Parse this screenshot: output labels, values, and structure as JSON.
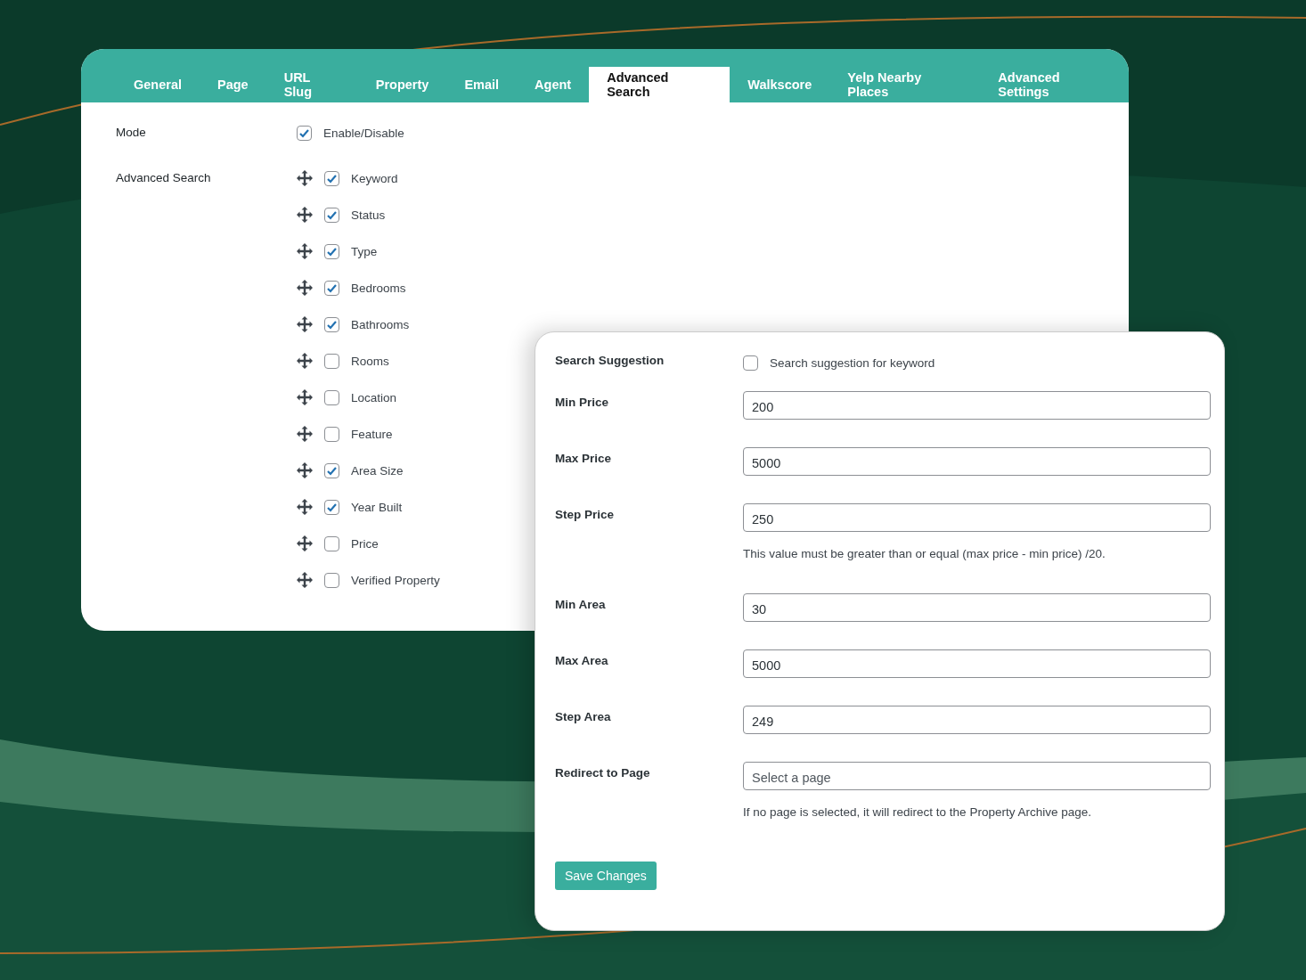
{
  "tabs": [
    {
      "label": "General",
      "selected": false
    },
    {
      "label": "Page",
      "selected": false
    },
    {
      "label": "URL Slug",
      "selected": false
    },
    {
      "label": "Property",
      "selected": false
    },
    {
      "label": "Email",
      "selected": false
    },
    {
      "label": "Agent",
      "selected": false
    },
    {
      "label": "Advanced Search",
      "selected": true
    },
    {
      "label": "Walkscore",
      "selected": false
    },
    {
      "label": "Yelp Nearby Places",
      "selected": false
    },
    {
      "label": "Advanced Settings",
      "selected": false
    }
  ],
  "mode": {
    "label": "Mode",
    "option_label": "Enable/Disable",
    "checked": true
  },
  "advanced_search": {
    "label": "Advanced Search",
    "items": [
      {
        "label": "Keyword",
        "checked": true
      },
      {
        "label": "Status",
        "checked": true
      },
      {
        "label": "Type",
        "checked": true
      },
      {
        "label": "Bedrooms",
        "checked": true
      },
      {
        "label": "Bathrooms",
        "checked": true
      },
      {
        "label": "Rooms",
        "checked": false
      },
      {
        "label": "Location",
        "checked": false
      },
      {
        "label": "Feature",
        "checked": false
      },
      {
        "label": "Area Size",
        "checked": true
      },
      {
        "label": "Year Built",
        "checked": true
      },
      {
        "label": "Price",
        "checked": false
      },
      {
        "label": "Verified Property",
        "checked": false
      }
    ]
  },
  "search_suggestion": {
    "label": "Search Suggestion",
    "option_label": "Search suggestion for keyword",
    "checked": false
  },
  "fields": [
    {
      "kind": "input",
      "label": "Min Price",
      "value": "200"
    },
    {
      "kind": "input",
      "label": "Max Price",
      "value": "5000"
    },
    {
      "kind": "input",
      "label": "Step Price",
      "value": "250",
      "help": "This value must be greater than or equal (max price - min price) /20."
    },
    {
      "kind": "input",
      "label": "Min Area",
      "value": "30"
    },
    {
      "kind": "input",
      "label": "Max Area",
      "value": "5000"
    },
    {
      "kind": "input",
      "label": "Step Area",
      "value": "249"
    },
    {
      "kind": "select",
      "label": "Redirect to Page",
      "placeholder": "Select a page",
      "help": "If no page is selected, it will redirect to the Property Archive page."
    }
  ],
  "save_button": "Save Changes"
}
